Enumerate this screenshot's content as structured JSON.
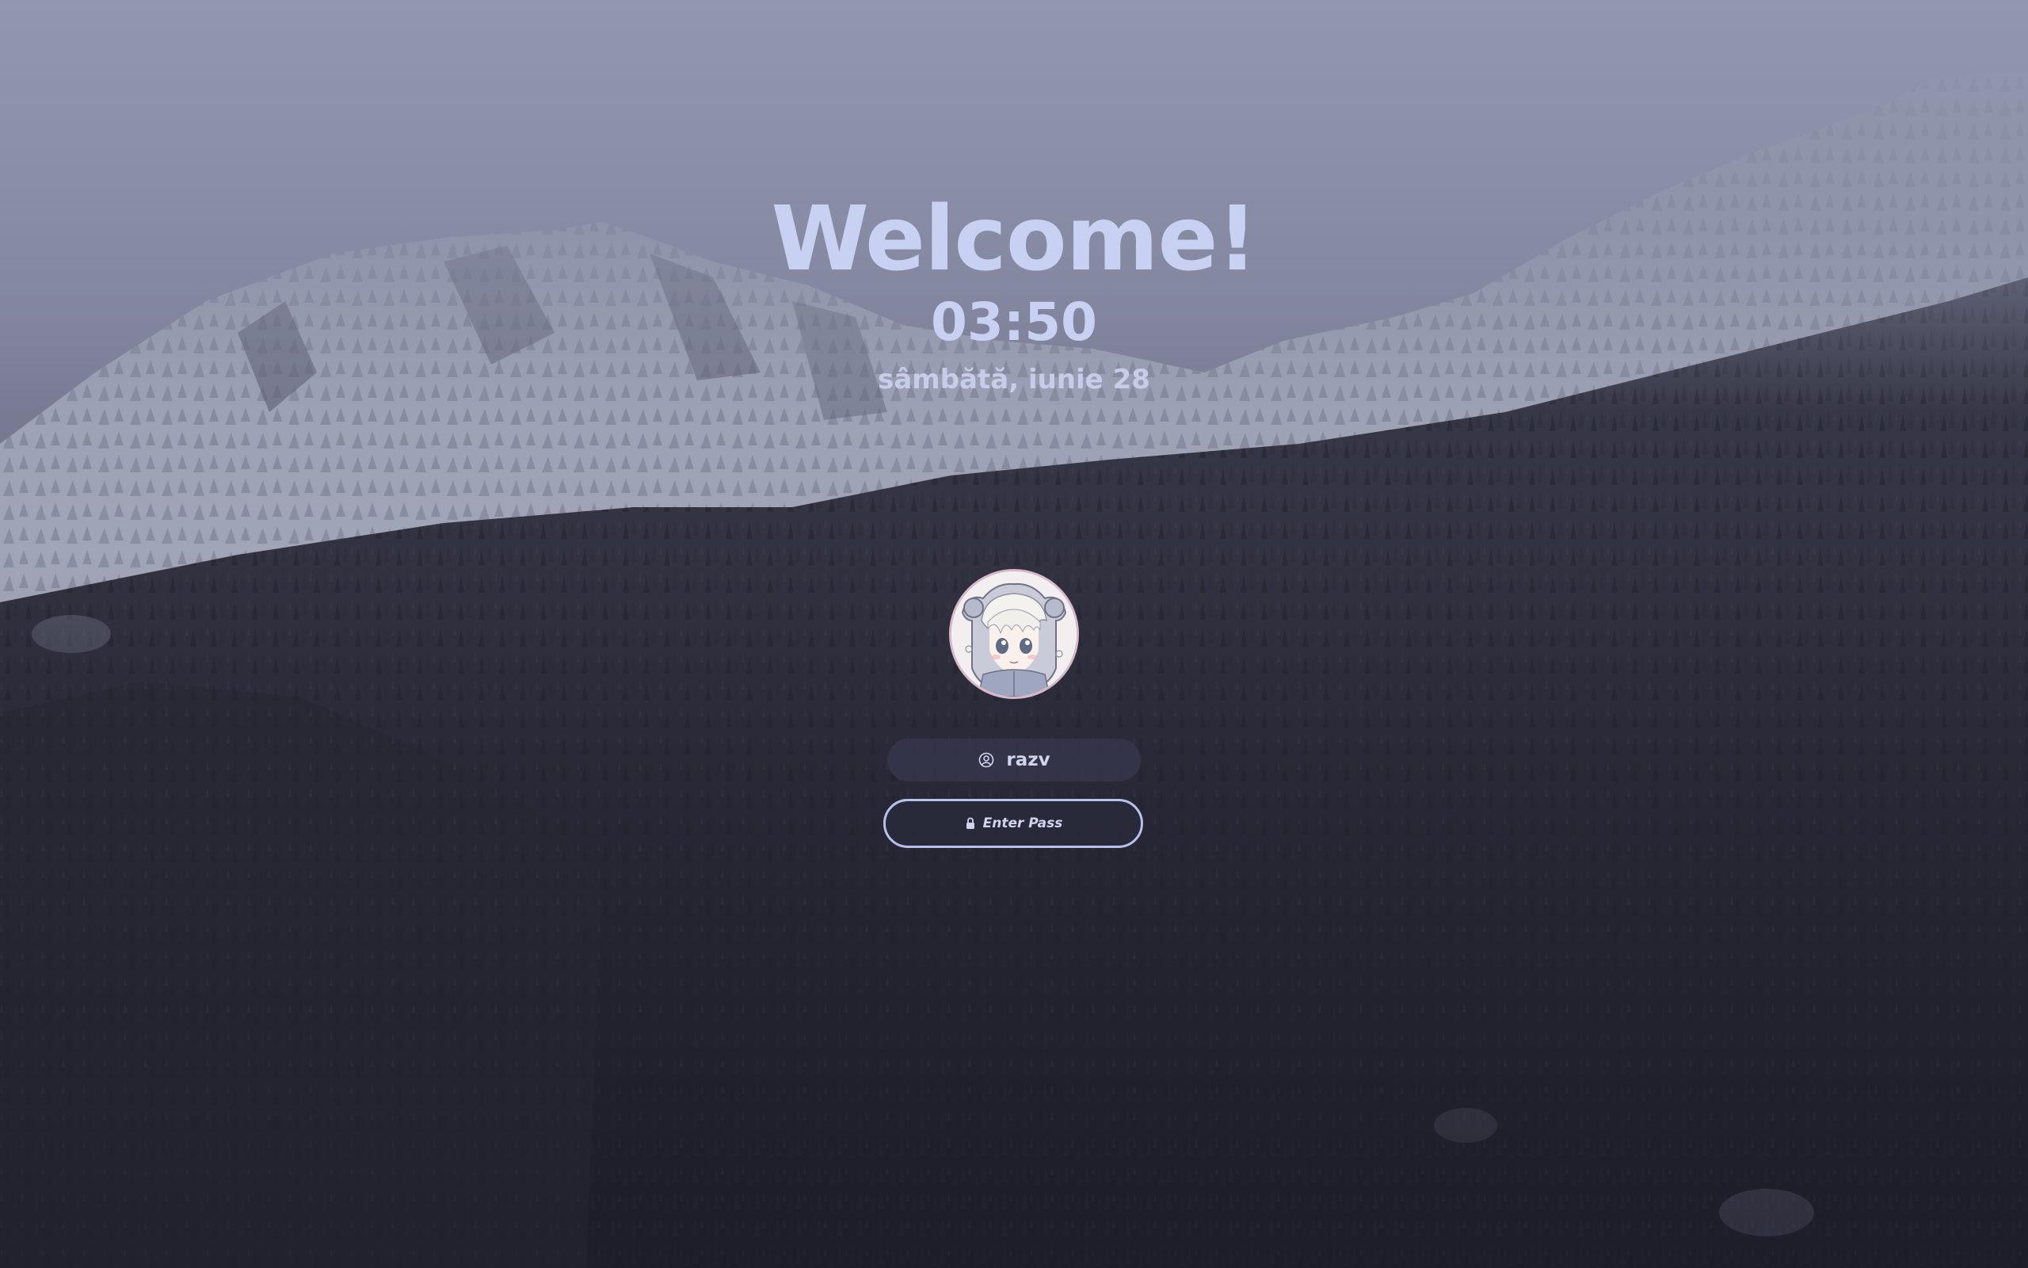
{
  "lockscreen": {
    "greeting": "Welcome!",
    "time": "03:50",
    "date": "sâmbătă, iunie 28"
  },
  "user": {
    "name": "razv",
    "icon": "user-circle-icon"
  },
  "password": {
    "placeholder": "Enter Pass",
    "icon": "lock-icon"
  },
  "colors": {
    "text": "#c9d1f2",
    "field_bg": "#34364a",
    "password_border": "#b9c0ec",
    "avatar_border": "#d8b8c8"
  }
}
